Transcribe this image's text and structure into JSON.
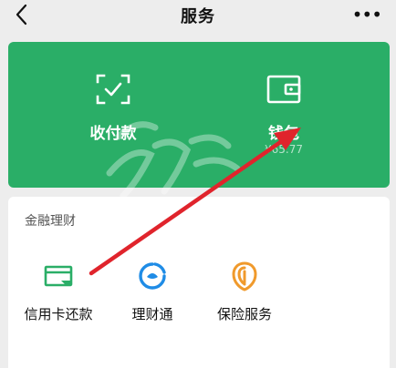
{
  "header": {
    "title": "服务",
    "more": "•••"
  },
  "payment_card": {
    "items": [
      {
        "label": "收付款",
        "icon": "scan-qr-icon"
      },
      {
        "label": "钱包",
        "sub": "¥65.77",
        "icon": "wallet-icon"
      }
    ],
    "background": "#2aae67"
  },
  "finance": {
    "title": "金融理财",
    "items": [
      {
        "label": "信用卡还款",
        "icon": "credit-card-icon",
        "color": "#2aae67"
      },
      {
        "label": "理财通",
        "icon": "licaitong-icon",
        "color": "#1f8ce6"
      },
      {
        "label": "保险服务",
        "icon": "insurance-icon",
        "color": "#f09a2c"
      }
    ]
  },
  "annotation": {
    "color": "#e0242c"
  }
}
